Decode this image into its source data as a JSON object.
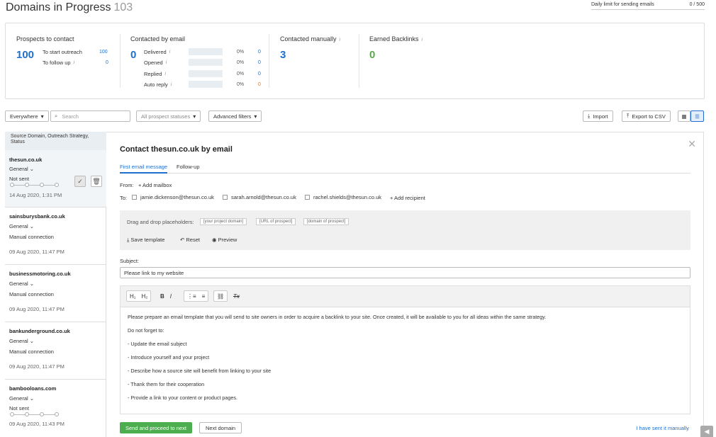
{
  "page": {
    "title": "Domains in Progress",
    "count": "103",
    "daily_limit_label": "Daily limit for sending emails",
    "daily_limit_value": "0 / 500"
  },
  "stats": {
    "prospects": {
      "heading": "Prospects to contact",
      "total": "100",
      "rows": [
        {
          "label": "To start outreach",
          "value": "100"
        },
        {
          "label": "To follow up",
          "value": "0"
        }
      ]
    },
    "contacted_email": {
      "heading": "Contacted by email",
      "total": "0",
      "rows": [
        {
          "label": "Delivered",
          "pct": "0%",
          "value": "0",
          "fill": 0
        },
        {
          "label": "Opened",
          "pct": "0%",
          "value": "0",
          "fill": 0
        },
        {
          "label": "Replied",
          "pct": "0%",
          "value": "0",
          "fill": 0
        },
        {
          "label": "Auto reply",
          "pct": "0%",
          "value": "0",
          "fill": 0
        }
      ]
    },
    "contacted_manually": {
      "heading": "Contacted manually",
      "total": "3"
    },
    "backlinks": {
      "heading": "Earned Backlinks",
      "total": "0"
    },
    "info_icon": "i"
  },
  "filters": {
    "scope": "Everywhere",
    "search_placeholder": "Search",
    "status": "All prospect statuses",
    "advanced": "Advanced filters",
    "import": "Import",
    "export": "Export to CSV"
  },
  "sidebar": {
    "header": "Source Domain, Outreach Strategy, Status",
    "items": [
      {
        "domain": "thesun.co.uk",
        "strategy": "General",
        "status": "Not sent",
        "date": "14 Aug 2020, 1:31 PM"
      },
      {
        "domain": "sainsburysbank.co.uk",
        "strategy": "General",
        "status": "Manual connection",
        "date": "09 Aug 2020, 11:47 PM"
      },
      {
        "domain": "businessmotoring.co.uk",
        "strategy": "General",
        "status": "Manual connection",
        "date": "09 Aug 2020, 11:47 PM"
      },
      {
        "domain": "bankunderground.co.uk",
        "strategy": "General",
        "status": "Manual connection",
        "date": "09 Aug 2020, 11:47 PM"
      },
      {
        "domain": "bambooloans.com",
        "strategy": "General",
        "status": "Not sent",
        "date": "09 Aug 2020, 11:43 PM"
      }
    ]
  },
  "main": {
    "title": "Contact thesun.co.uk by email",
    "tabs": [
      "First email message",
      "Follow-up"
    ],
    "from_label": "From:",
    "add_mailbox": "+ Add mailbox",
    "to_label": "To:",
    "recipients": [
      "jamie.dickenson@thesun.co.uk",
      "sarah.arnold@thesun.co.uk",
      "rachel.shields@thesun.co.uk"
    ],
    "add_recipient": "+ Add recipient",
    "placeholders_label": "Drag and drop placeholders:",
    "placeholders": [
      "[your project domain]",
      "[URL of prospect]",
      "[domain of prospect]"
    ],
    "save_template": "Save template",
    "reset": "Reset",
    "preview": "Preview",
    "subject_label": "Subject:",
    "subject_value": "Please link to my website",
    "toolbar": {
      "h1": "H₁",
      "h2": "H₂",
      "bold": "B",
      "italic": "I"
    },
    "body": [
      "Please prepare an email template that you will send to site owners in order to acquire a backlink to your site. Once created, it will be available to you for all ideas within the same strategy.",
      "Do not forget to:",
      "- Update the email subject",
      "- Introduce yourself and your project",
      "- Describe how a source site will benefit from linking to your site",
      "- Thank them for their cooperation",
      "- Provide a link to your content or product pages."
    ],
    "send_button": "Send and proceed to next",
    "next_button": "Next domain",
    "manual_link": "I have sent it manually"
  }
}
